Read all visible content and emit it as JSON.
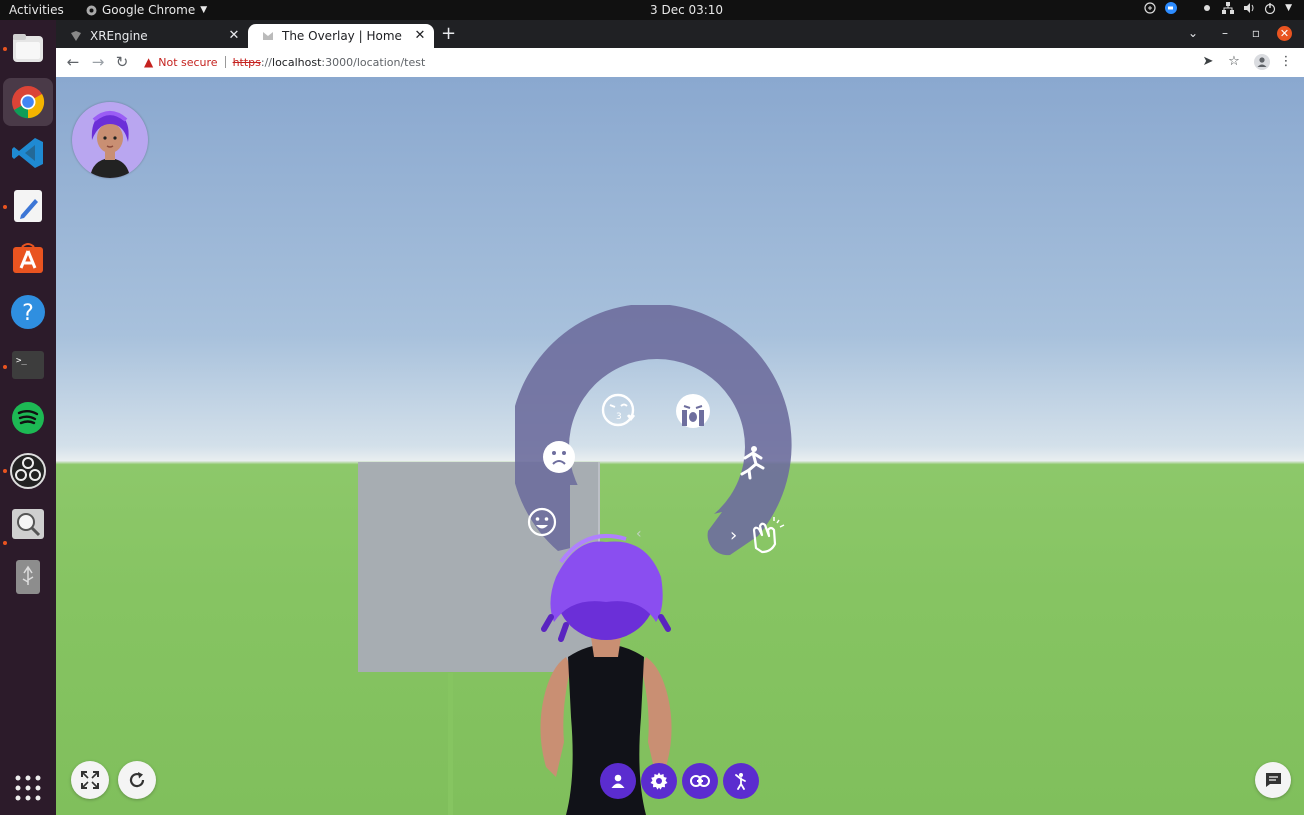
{
  "system_bar": {
    "activities": "Activities",
    "app_menu": "Google Chrome",
    "clock": "3 Dec  03:10"
  },
  "dock": {
    "items": [
      "files",
      "google-chrome",
      "vscode",
      "text-editor",
      "ubuntu-software",
      "help",
      "terminal",
      "spotify",
      "obs-studio",
      "screenshot",
      "usb-drive",
      "show-applications"
    ]
  },
  "browser": {
    "tabs": [
      {
        "title": "XREngine",
        "active": false
      },
      {
        "title": "The Overlay | Home",
        "active": true
      }
    ],
    "security_label": "Not secure",
    "url": {
      "scheme": "https",
      "sep": "://",
      "host": "localhost",
      "path": ":3000/location/test"
    }
  },
  "scene": {
    "emote_wheel": {
      "emotes": [
        "smile",
        "sad",
        "kiss-wink",
        "crying",
        "running",
        "clapping"
      ],
      "next_label": "›",
      "prev_label": "‹"
    },
    "bottom_left_buttons": [
      "fullscreen",
      "refresh"
    ],
    "bottom_center_buttons": [
      "profile",
      "settings",
      "share-link",
      "emote"
    ],
    "bottom_right_buttons": [
      "chat"
    ]
  },
  "colors": {
    "accent_purple": "#5b2ccf",
    "wheel_fill": "#6e6e9e",
    "avatar_bg": "#b9a6f0",
    "ubuntu_orange": "#e95420"
  }
}
